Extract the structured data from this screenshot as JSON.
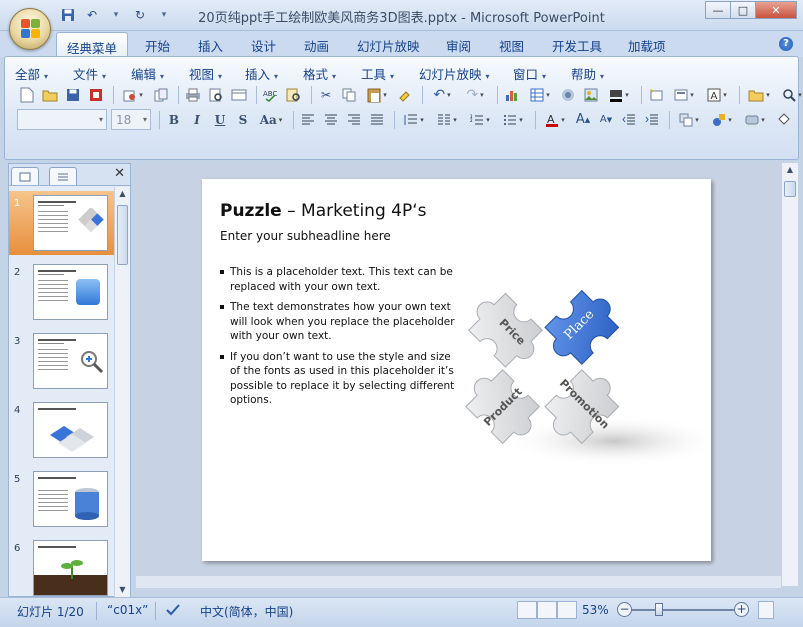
{
  "window": {
    "title": "20页纯ppt手工绘制欧美风商务3D图表.pptx - Microsoft PowerPoint",
    "controls": [
      "—",
      "□",
      "✕"
    ]
  },
  "ribbon_tabs": [
    "经典菜单",
    "开始",
    "插入",
    "设计",
    "动画",
    "幻灯片放映",
    "审阅",
    "视图",
    "开发工具",
    "加载项"
  ],
  "active_tab": "经典菜单",
  "classic_menu": [
    "全部",
    "文件",
    "编辑",
    "视图",
    "插入",
    "格式",
    "工具",
    "幻灯片放映",
    "窗口",
    "帮助"
  ],
  "font_size_value": "18",
  "slide_panel": {
    "selected": 1,
    "slide_numbers": [
      "1",
      "2",
      "3",
      "4",
      "5",
      "6"
    ]
  },
  "slide": {
    "title_bold": "Puzzle",
    "title_rest": " – Marketing 4P‘s",
    "subtitle": "Enter your subheadline  here",
    "bullets": [
      "This is a placeholder text. This text can be replaced with your own text.",
      "The text demonstrates how your own text will look when you replace the placeholder with your own text.",
      "If you don’t want to use the style and size of the fonts as used in this placeholder it’s possible to replace it by selecting different options."
    ],
    "puzzle_labels": {
      "price": "Price",
      "place": "Place",
      "product": "Product",
      "promotion": "Promotion"
    },
    "colors": {
      "place_piece": "#3a74d8",
      "grey_piece": "#d9dadc"
    }
  },
  "status": {
    "slide_counter": "幻灯片 1/20",
    "theme": "“c01x”",
    "language": "中文(简体，中国)",
    "zoom": "53%"
  }
}
